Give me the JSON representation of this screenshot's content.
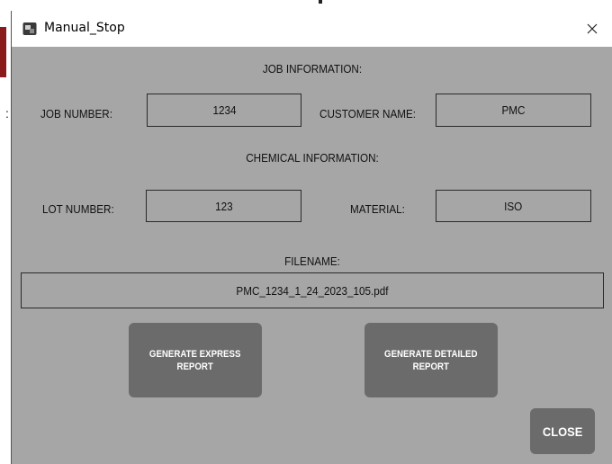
{
  "window": {
    "title": "Manual_Stop"
  },
  "job_section": {
    "heading": "JOB INFORMATION:",
    "job_number_label": "JOB NUMBER:",
    "job_number_value": "1234",
    "customer_name_label": "CUSTOMER NAME:",
    "customer_name_value": "PMC"
  },
  "chemical_section": {
    "heading": "CHEMICAL INFORMATION:",
    "lot_number_label": "LOT NUMBER:",
    "lot_number_value": "123",
    "material_label": "MATERIAL:",
    "material_value": "ISO"
  },
  "file": {
    "label": "FILENAME:",
    "value": "PMC_1234_1_24_2023_105.pdf"
  },
  "buttons": {
    "express": "GENERATE EXPRESS\nREPORT",
    "detailed": "GENERATE DETAILED\nREPORT",
    "close": "CLOSE"
  },
  "colors": {
    "panel_bg": "#a6a6a6",
    "button_bg": "#6b6b6b",
    "button_text": "#ffffff"
  }
}
